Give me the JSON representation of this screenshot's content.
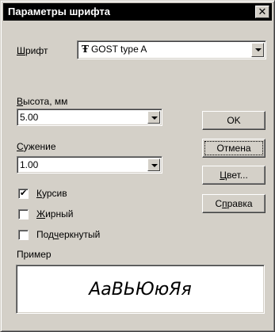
{
  "window": {
    "title": "Параметры шрифта"
  },
  "font": {
    "label_ul": "Ш",
    "label_rest": "рифт",
    "icon": "truetype-font-icon",
    "icon_glyph": "Ŧ",
    "value": "GOST type A"
  },
  "height": {
    "label_ul": "В",
    "label_rest": "ысота, мм",
    "value": "5.00"
  },
  "narrowing": {
    "label_ul": "С",
    "label_rest": "ужение",
    "value": "1.00"
  },
  "buttons": {
    "ok": "OK",
    "cancel": "Отмена",
    "color_ul": "Ц",
    "color_rest": "вет...",
    "help_pre": "С",
    "help_ul": "п",
    "help_rest": "равка"
  },
  "checkboxes": {
    "italic": {
      "label_ul": "К",
      "label_rest": "урсив",
      "checked": true
    },
    "bold": {
      "label_ul": "Ж",
      "label_rest": "ирный",
      "checked": false
    },
    "underline": {
      "label_pre": "Под",
      "label_ul": "ч",
      "label_rest": "еркнутый",
      "checked": false
    }
  },
  "sample": {
    "label": "Пример",
    "text": "АаВЬЮюЯя"
  }
}
